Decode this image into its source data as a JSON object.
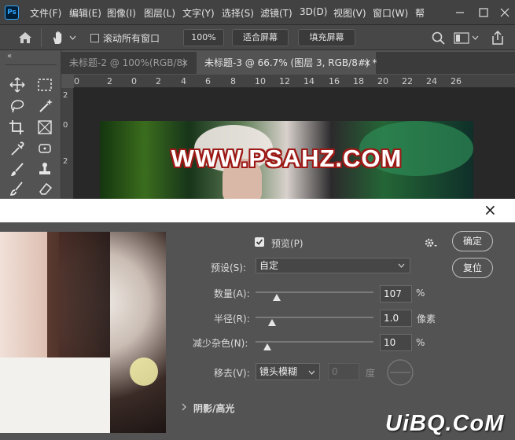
{
  "app": {
    "logo": "Ps"
  },
  "menu": [
    "文件(F)",
    "编辑(E)",
    "图像(I)",
    "图层(L)",
    "文字(Y)",
    "选择(S)",
    "滤镜(T)",
    "3D(D)",
    "视图(V)",
    "窗口(W)",
    "帮"
  ],
  "options": {
    "scroll_all_label": "滚动所有窗口",
    "zoom_value": "100%",
    "fit_screen": "适合屏幕",
    "fill_screen": "填充屏幕"
  },
  "tabs": [
    {
      "label": "未标题-2 @ 100%(RGB/8)",
      "close": "×"
    },
    {
      "label": "未标题-3 @ 66.7% (图层 3, RGB/8#) *",
      "close": "×"
    }
  ],
  "ruler": {
    "h": [
      "0",
      "2",
      "0",
      "2",
      "4",
      "6",
      "8",
      "10",
      "12",
      "14",
      "16",
      "18",
      "20",
      "22",
      "24",
      "26"
    ],
    "v": [
      "2",
      "0",
      "2"
    ]
  },
  "banner_text": "WWW.PSAHZ.COM",
  "dialog": {
    "close": "×",
    "preview_label": "预览(P)",
    "ok": "确定",
    "reset": "复位",
    "preset_label": "预设(S):",
    "preset_value": "自定",
    "amount_label": "数量(A):",
    "amount_value": "107",
    "amount_unit": "%",
    "radius_label": "半径(R):",
    "radius_value": "1.0",
    "radius_unit": "像素",
    "noise_label": "减少杂色(N):",
    "noise_value": "10",
    "noise_unit": "%",
    "remove_label": "移去(V):",
    "remove_value": "镜头模糊",
    "angle_value": "0",
    "angle_unit": "度",
    "shadows_label": "阴影/高光"
  },
  "sliders": {
    "amount": 0.18,
    "radius": 0.14,
    "noise": 0.1
  },
  "watermark": "UiBQ.CoM",
  "colors": {
    "accent": "#31a8ff",
    "menubar": "#424242",
    "panel": "#535353",
    "banner_text_stroke": "#9c1916"
  }
}
